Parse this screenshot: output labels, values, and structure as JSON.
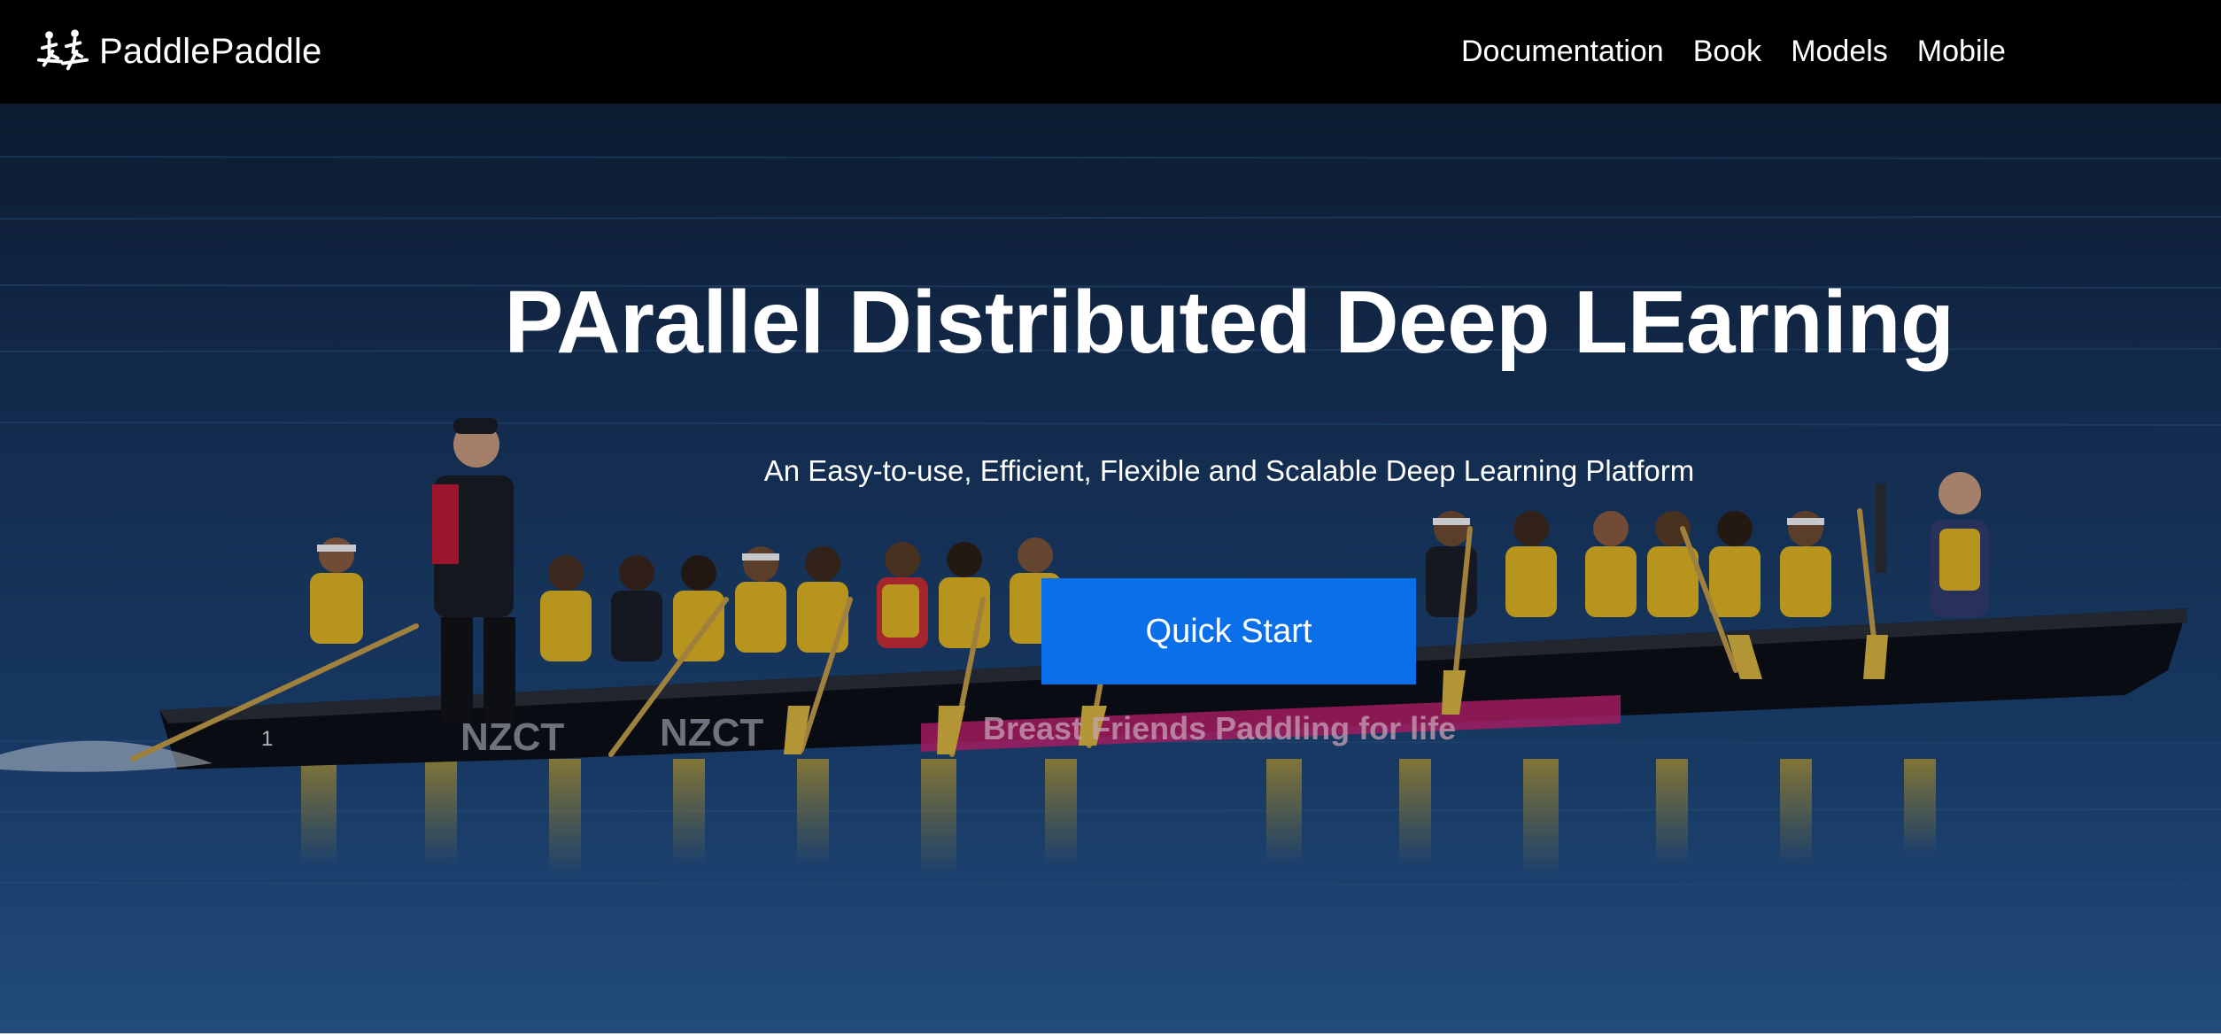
{
  "nav": {
    "brand": "PaddlePaddle",
    "logo_icon": "paddlers-logo-icon",
    "links": [
      {
        "label": "Documentation"
      },
      {
        "label": "Book"
      },
      {
        "label": "Models"
      },
      {
        "label": "Mobile"
      }
    ]
  },
  "hero": {
    "title": "PArallel Distributed Deep LEarning",
    "subtitle": "An Easy-to-use, Efficient, Flexible and Scalable Deep Learning Platform",
    "cta_label": "Quick Start",
    "background_image": "dragon-boat-rowing-team-photo",
    "boat_text_1": "NZCT",
    "boat_text_2": "NZCT",
    "boat_banner_text": "Breast Friends Paddling for life",
    "boat_number": "1"
  },
  "colors": {
    "navbar_bg": "#000000",
    "cta_bg": "#0a6fe8",
    "text": "#ffffff"
  }
}
